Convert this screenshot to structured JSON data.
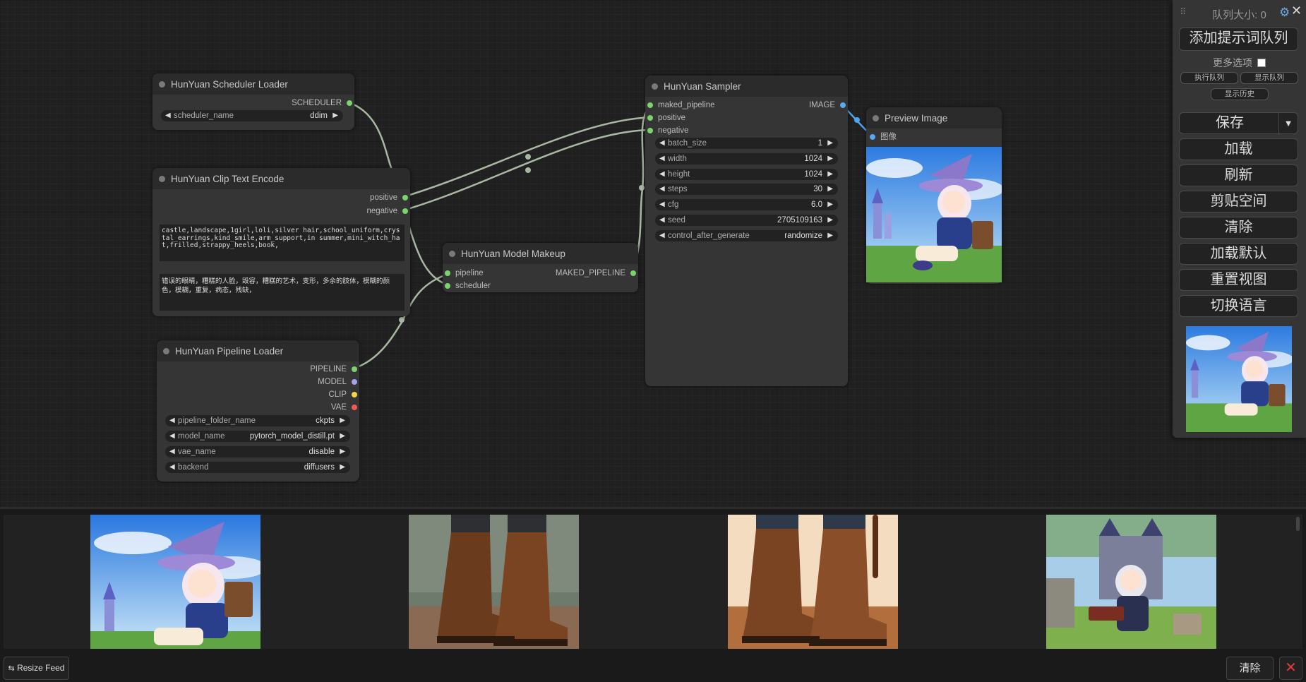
{
  "colors": {
    "pin_green": "#7bd36b",
    "pin_blue": "#5aa7f2",
    "pin_yellow": "#f0d64a",
    "pin_red": "#f05a5a",
    "pin_lavender": "#a3a3f0",
    "wire": "#a9b8a3",
    "wire_blue": "#4fa5f0",
    "close_red": "#e23b3b"
  },
  "nodes": {
    "scheduler_loader": {
      "title": "HunYuan Scheduler Loader",
      "output": "SCHEDULER",
      "widget": {
        "name": "scheduler_name",
        "value": "ddim"
      }
    },
    "clip_text_encode": {
      "title": "HunYuan Clip Text Encode",
      "outputs": [
        "positive",
        "negative"
      ],
      "positive_text": "castle,landscape,1girl,loli,silver hair,school_uniform,crystal_earrings,kind_smile,arm_support,in summer,mini_witch_hat,frilled,strappy_heels,book,",
      "negative_text": "错误的眼睛，糟糕的人脸，毁容，糟糕的艺术，变形，多余的肢体，模糊的颜色，模糊，重复，病态，残缺，"
    },
    "pipeline_loader": {
      "title": "HunYuan Pipeline Loader",
      "outputs": [
        "PIPELINE",
        "MODEL",
        "CLIP",
        "VAE"
      ],
      "widgets": [
        {
          "name": "pipeline_folder_name",
          "value": "ckpts"
        },
        {
          "name": "model_name",
          "value": "pytorch_model_distill.pt"
        },
        {
          "name": "vae_name",
          "value": "disable"
        },
        {
          "name": "backend",
          "value": "diffusers"
        }
      ]
    },
    "model_makeup": {
      "title": "HunYuan Model Makeup",
      "inputs": [
        "pipeline",
        "scheduler"
      ],
      "output": "MAKED_PIPELINE"
    },
    "sampler": {
      "title": "HunYuan Sampler",
      "inputs": [
        "maked_pipeline",
        "positive",
        "negative"
      ],
      "output": "IMAGE",
      "widgets": [
        {
          "name": "batch_size",
          "value": "1"
        },
        {
          "name": "width",
          "value": "1024"
        },
        {
          "name": "height",
          "value": "1024"
        },
        {
          "name": "steps",
          "value": "30"
        },
        {
          "name": "cfg",
          "value": "6.0"
        },
        {
          "name": "seed",
          "value": "2705109163"
        },
        {
          "name": "control_after_generate",
          "value": "randomize"
        }
      ]
    },
    "preview": {
      "title": "Preview Image",
      "input": "图像"
    }
  },
  "menu": {
    "queue_size_label": "队列大小: 0",
    "queue_prompt": "添加提示词队列",
    "more_options": "更多选项",
    "run_queue": "执行队列",
    "show_queue": "显示队列",
    "show_history": "显示历史",
    "save": "保存",
    "save_dropdown": "▼",
    "load": "加载",
    "refresh": "刷新",
    "clipspace": "剪贴空间",
    "clear": "清除",
    "load_default": "加载默认",
    "reset_view": "重置视图",
    "switch_language": "切换语言"
  },
  "feed": {
    "resize_label": "Resize Feed",
    "clear_label": "清除",
    "close_label": "✕"
  },
  "icons": {
    "gear": "⚙",
    "close": "✕",
    "grip": "⠿",
    "arrow_left": "◀",
    "arrow_right": "▶",
    "resize": "⇆"
  }
}
